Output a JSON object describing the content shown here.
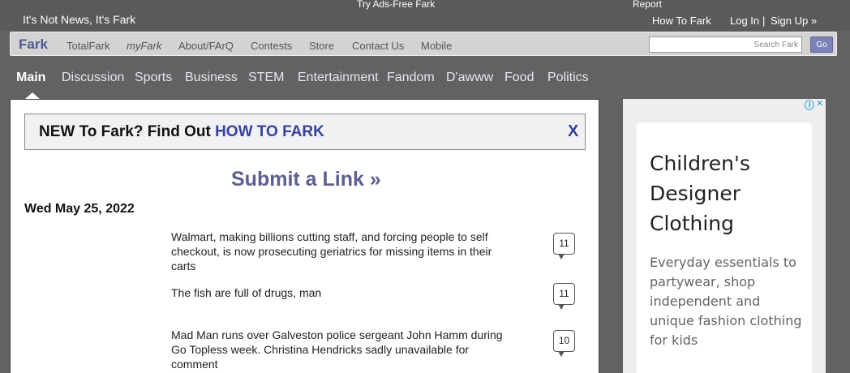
{
  "header": {
    "tagline": "It's Not News, It's Fark",
    "ads_free": "Try Ads-Free Fark",
    "report": "Report",
    "how_to_fark": "How To Fark",
    "login": "Log In",
    "separator": "|",
    "signup": "Sign Up »"
  },
  "nav": {
    "items": [
      "Fark",
      "TotalFark",
      "myFark",
      "About/FArQ",
      "Contests",
      "Store",
      "Contact Us",
      "Mobile"
    ],
    "search_placeholder": "Search Fark",
    "go_label": "Go"
  },
  "categories": {
    "items": [
      "Main",
      "Discussion",
      "Sports",
      "Business",
      "STEM",
      "Entertainment",
      "Fandom",
      "D'awww",
      "Food",
      "Politics"
    ],
    "active": "Main"
  },
  "banner": {
    "prefix": "NEW To Fark? Find Out ",
    "link": "HOW TO FARK",
    "close": "X"
  },
  "submit_link": "Submit a Link »",
  "date": "Wed May 25, 2022",
  "stories": [
    {
      "headline": "Walmart, making billions cutting staff, and forcing people to self checkout, is now prosecuting geriatrics for missing items in their carts",
      "comments": "11"
    },
    {
      "headline": "The fish are full of drugs, man",
      "comments": "11"
    },
    {
      "headline": "Mad Man runs over Galveston police sergeant John Hamm during Go Topless week. Christina Hendricks sadly unavailable for comment",
      "comments": "10"
    }
  ],
  "ad": {
    "title": "Children's Designer Clothing",
    "body": "Everyday essentials to partywear, shop independent and unique fashion clothing for kids",
    "accent_color": "#1a9bd7"
  },
  "colors": {
    "brand": "#4e5a8f",
    "link": "#35419a",
    "background": "#626262"
  }
}
